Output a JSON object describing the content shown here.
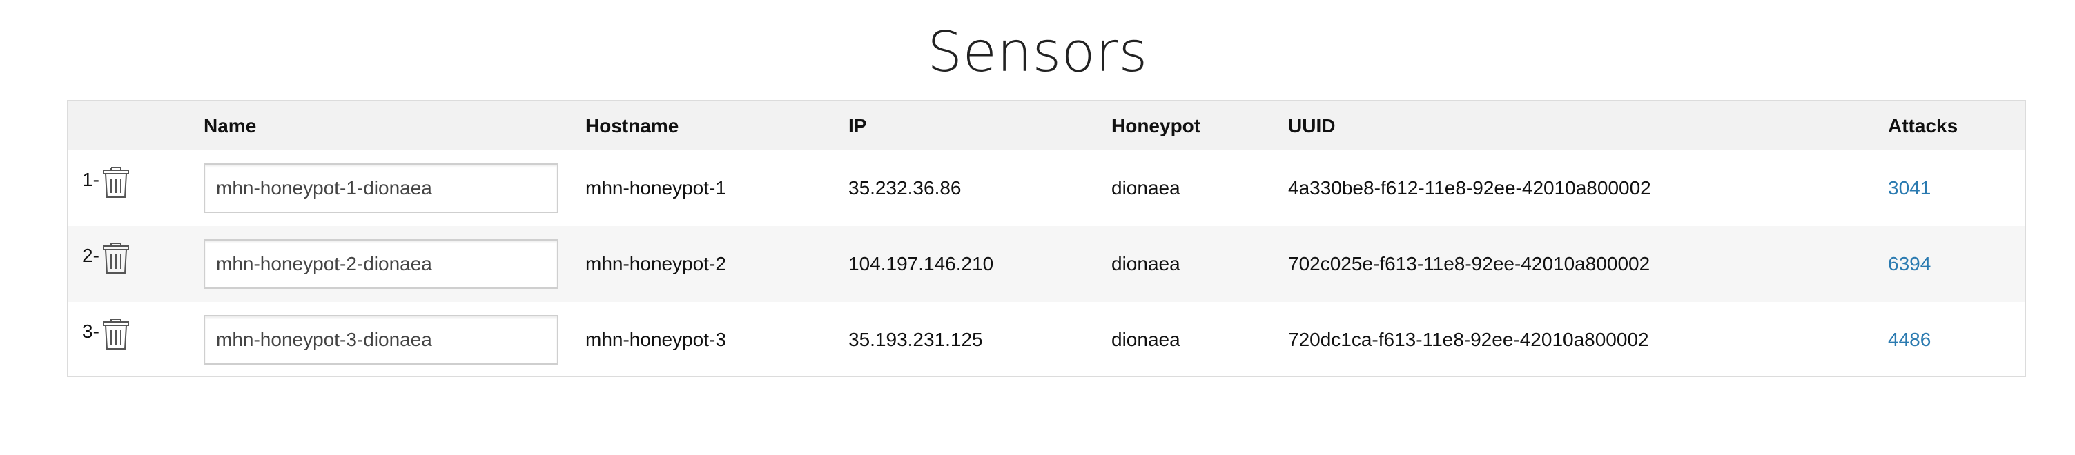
{
  "page": {
    "title": "Sensors"
  },
  "table": {
    "headers": {
      "name": "Name",
      "hostname": "Hostname",
      "ip": "IP",
      "honeypot": "Honeypot",
      "uuid": "UUID",
      "attacks": "Attacks"
    },
    "rows": [
      {
        "index": "1-",
        "name": "mhn-honeypot-1-dionaea",
        "hostname": "mhn-honeypot-1",
        "ip": "35.232.36.86",
        "honeypot": "dionaea",
        "uuid": "4a330be8-f612-11e8-92ee-42010a800002",
        "attacks": "3041"
      },
      {
        "index": "2-",
        "name": "mhn-honeypot-2-dionaea",
        "hostname": "mhn-honeypot-2",
        "ip": "104.197.146.210",
        "honeypot": "dionaea",
        "uuid": "702c025e-f613-11e8-92ee-42010a800002",
        "attacks": "6394"
      },
      {
        "index": "3-",
        "name": "mhn-honeypot-3-dionaea",
        "hostname": "mhn-honeypot-3",
        "ip": "35.193.231.125",
        "honeypot": "dionaea",
        "uuid": "720dc1ca-f613-11e8-92ee-42010a800002",
        "attacks": "4486"
      }
    ]
  },
  "icons": {
    "delete": "trash-icon"
  },
  "colors": {
    "link": "#2a7ab0",
    "header_bg": "#f2f2f2",
    "alt_row_bg": "#f6f6f6",
    "border": "#dcdcdc"
  }
}
